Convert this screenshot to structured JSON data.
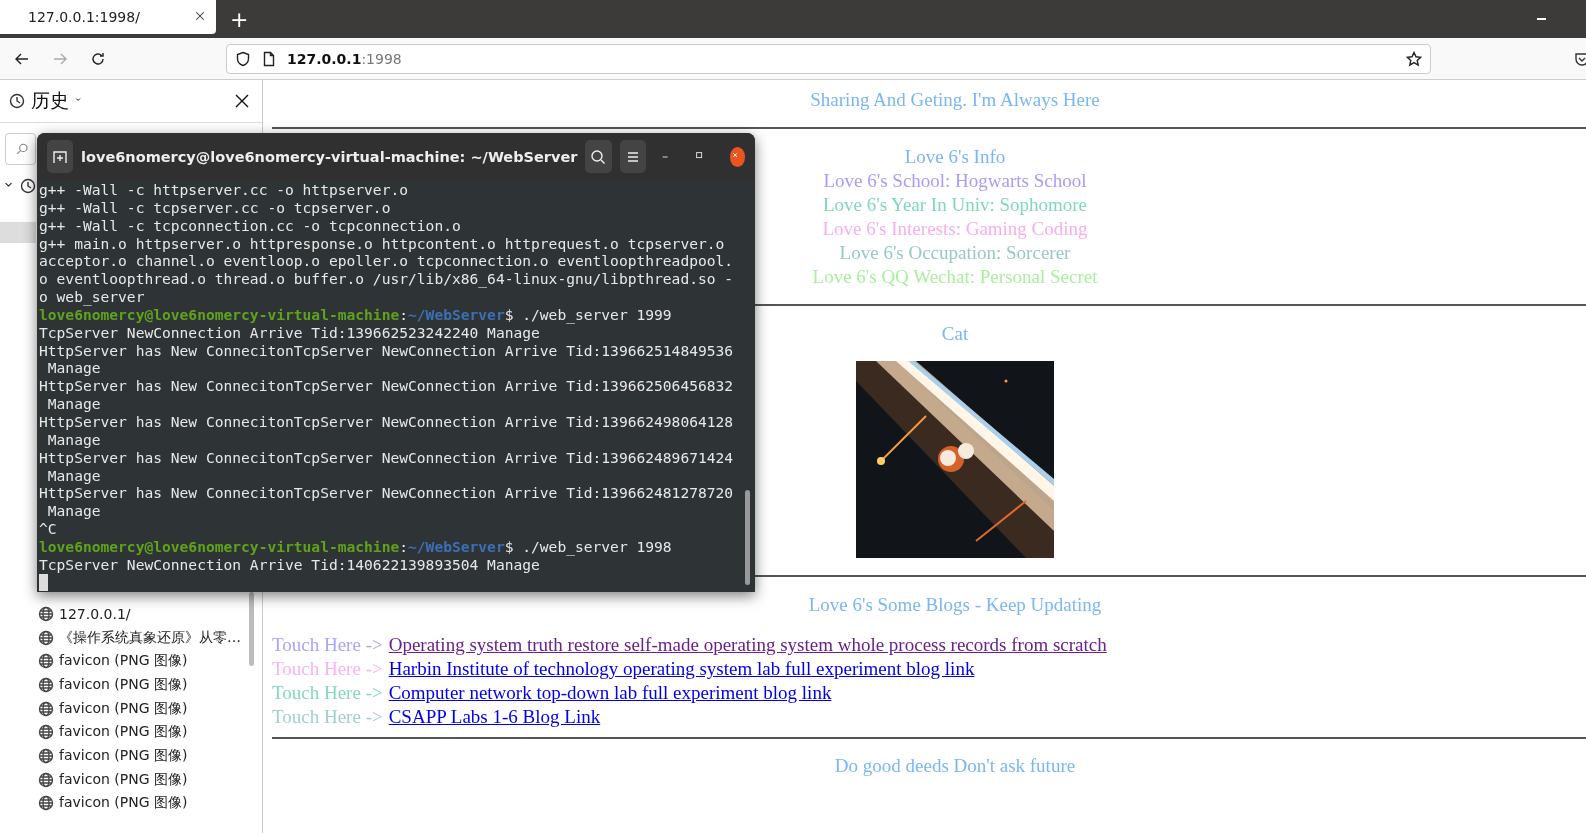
{
  "browser": {
    "tabs": [
      {
        "title": "127.0.0.1:1998/",
        "selected": true
      }
    ],
    "new_tab": "+",
    "address": {
      "host": "127.0.0.1",
      "port": ":1998"
    },
    "forward_disabled": true
  },
  "sidebar": {
    "title": "历史",
    "group_expanded": true,
    "items": [
      {
        "selected": true
      },
      {
        "title": "127.0.0.1/",
        "selected": false
      },
      {
        "title": "《操作系统真象还原》从零…",
        "selected": false
      },
      {
        "title": "favicon (PNG 图像)",
        "selected": false
      },
      {
        "title": "favicon (PNG 图像)",
        "selected": false
      },
      {
        "title": "favicon (PNG 图像)",
        "selected": false
      },
      {
        "title": "favicon (PNG 图像)",
        "selected": false
      },
      {
        "title": "favicon (PNG 图像)",
        "selected": false
      },
      {
        "title": "favicon (PNG 图像)",
        "selected": false
      },
      {
        "title": "favicon (PNG 图像)",
        "selected": false
      }
    ]
  },
  "terminal": {
    "title": "love6nomercy@love6nomercy-virtual-machine: ~/WebServer",
    "lines": [
      {
        "kind": "output",
        "text": "g++ -Wall -c httpserver.cc -o httpserver.o"
      },
      {
        "kind": "output",
        "text": "g++ -Wall -c tcpserver.cc -o tcpserver.o"
      },
      {
        "kind": "output",
        "text": "g++ -Wall -c tcpconnection.cc -o tcpconnection.o"
      },
      {
        "kind": "output",
        "text": "g++ main.o httpserver.o httpresponse.o httpcontent.o httprequest.o tcpserver.o"
      },
      {
        "kind": "output",
        "text": "acceptor.o channel.o eventloop.o epoller.o tcpconnection.o eventloopthreadpool."
      },
      {
        "kind": "output",
        "text": "o eventloopthread.o thread.o buffer.o /usr/lib/x86_64-linux-gnu/libpthread.so -"
      },
      {
        "kind": "output",
        "text": "o web_server"
      },
      {
        "kind": "prompt",
        "user": "love6nomercy@love6nomercy-virtual-machine",
        "sep": ":",
        "path": "~/WebServer",
        "text": "$ ./web_server 1999"
      },
      {
        "kind": "output",
        "text": "TcpServer NewConnection Arrive Tid:139662523242240 Manage"
      },
      {
        "kind": "output",
        "text": "HttpServer has New ConnecitonTcpServer NewConnection Arrive Tid:139662514849536"
      },
      {
        "kind": "output",
        "text": " Manage"
      },
      {
        "kind": "output",
        "text": "HttpServer has New ConnecitonTcpServer NewConnection Arrive Tid:139662506456832"
      },
      {
        "kind": "output",
        "text": " Manage"
      },
      {
        "kind": "output",
        "text": "HttpServer has New ConnecitonTcpServer NewConnection Arrive Tid:139662498064128"
      },
      {
        "kind": "output",
        "text": " Manage"
      },
      {
        "kind": "output",
        "text": "HttpServer has New ConnecitonTcpServer NewConnection Arrive Tid:139662489671424"
      },
      {
        "kind": "output",
        "text": " Manage"
      },
      {
        "kind": "output",
        "text": "HttpServer has New ConnecitonTcpServer NewConnection Arrive Tid:139662481278720"
      },
      {
        "kind": "output",
        "text": " Manage"
      },
      {
        "kind": "output",
        "text": "^C"
      },
      {
        "kind": "prompt",
        "user": "love6nomercy@love6nomercy-virtual-machine",
        "sep": ":",
        "path": "~/WebServer",
        "text": "$ ./web_server 1998"
      },
      {
        "kind": "output",
        "text": "TcpServer NewConnection Arrive Tid:140622139893504 Manage"
      },
      {
        "kind": "cursor"
      }
    ]
  },
  "page": {
    "heading": "Sharing And Geting. I'm Always Here",
    "info": [
      {
        "text": "Love 6's Info",
        "color": "#79b6f4"
      },
      {
        "text": "Love 6's School: Hogwarts School",
        "color": "#a99cf6"
      },
      {
        "text": "Love 6's Year In Univ: Sophomore",
        "color": "#7fd9b9"
      },
      {
        "text": "Love 6's Interests: Gaming Coding",
        "color": "#fbacef"
      },
      {
        "text": "Love 6's Occupation: Sorcerer",
        "color": "#98c8c4"
      },
      {
        "text": "Love 6's QQ Wechat: Personal Secret",
        "color": "#a9ef9f"
      }
    ],
    "image_title": "Cat",
    "blogs_title": "Love 6's Some Blogs - Keep Updating",
    "blogs": [
      {
        "prefix": "Touch Here ->",
        "color": "#a8a4f7",
        "link": "Operating system truth restore self-made operating system whole process records from scratch",
        "visited": true
      },
      {
        "prefix": "Touch Here ->",
        "color": "#fab2f1",
        "link": "Harbin Institute of technology operating system lab full experiment blog link",
        "visited": false
      },
      {
        "prefix": "Touch Here ->",
        "color": "#82d8bf",
        "link": "Computer network top-down lab full experiment blog link",
        "visited": false
      },
      {
        "prefix": "Touch Here ->",
        "color": "#9fcfce",
        "link": "CSAPP Labs 1-6 Blog Link",
        "visited": false
      }
    ],
    "footer": "Do good deeds Don't ask future"
  }
}
